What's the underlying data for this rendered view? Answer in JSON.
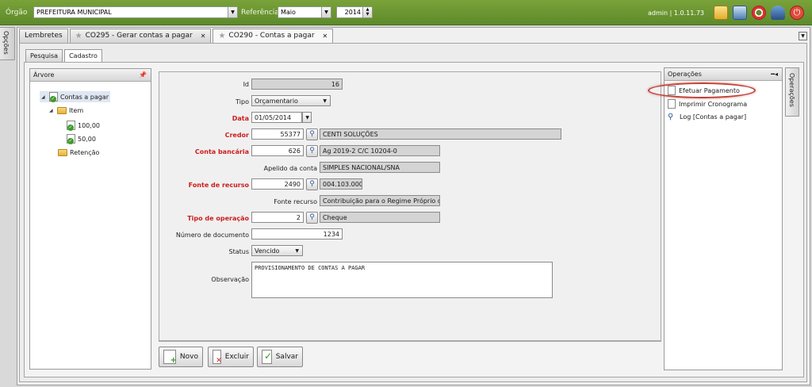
{
  "topbar": {
    "orgao_label": "Órgão",
    "orgao_value": "PREFEITURA MUNICIPAL",
    "referencia_label": "Referência",
    "mes_value": "Maio",
    "ano_value": "2014",
    "user_info": "admin | 1.0.11.73"
  },
  "sidebar_tab": "Opções",
  "tabs": [
    {
      "label": "Lembretes"
    },
    {
      "label": "CO295 - Gerar contas a pagar"
    },
    {
      "label": "CO290 - Contas a pagar"
    }
  ],
  "subtabs": [
    "Pesquisa",
    "Cadastro"
  ],
  "tree": {
    "title": "Árvore",
    "nodes": [
      "Contas a pagar",
      "Item",
      "100,00",
      "50,00",
      "Retenção"
    ]
  },
  "form": {
    "id_label": "Id",
    "id_value": "16",
    "tipo_label": "Tipo",
    "tipo_value": "Orçamentario",
    "data_label": "Data",
    "data_value": "01/05/2014",
    "credor_label": "Credor",
    "credor_code": "55377",
    "credor_name": "CENTI SOLUÇÕES",
    "conta_label": "Conta bancária",
    "conta_code": "626",
    "conta_name": "Ag 2019-2 C/C 10204-0",
    "apelido_label": "Apelido da conta",
    "apelido_value": "SIMPLES NACIONAL/SNA",
    "fonte_label": "Fonte de recurso",
    "fonte_code": "2490",
    "fonte_name": "004.103.000",
    "fonte_rec_label": "Fonte recurso",
    "fonte_rec_value": "Contribuição para o Regime Próprio de",
    "tipo_op_label": "Tipo de operação",
    "tipo_op_code": "2",
    "tipo_op_name": "Cheque",
    "num_doc_label": "Número de documento",
    "num_doc_value": "1234",
    "status_label": "Status",
    "status_value": "Vencido",
    "obs_label": "Observação",
    "obs_value": "PROVISIONAMENTO DE CONTAS A PAGAR"
  },
  "buttons": {
    "novo": "Novo",
    "excluir": "Excluir",
    "salvar": "Salvar"
  },
  "operations": {
    "title": "Operações",
    "items": [
      "Efetuar Pagamento",
      "Imprimir Cronograma",
      "Log [Contas a pagar]"
    ],
    "side_tab": "Operações"
  }
}
